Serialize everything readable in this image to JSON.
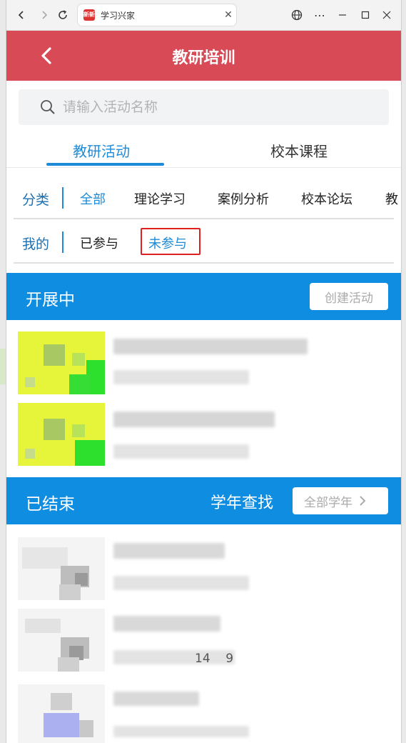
{
  "browser": {
    "tab_title": "学习兴家",
    "favicon_text": "新新",
    "icons": [
      "back-arrow-icon",
      "forward-arrow-icon",
      "refresh-icon",
      "close-icon",
      "globe-icon",
      "more-icon",
      "minimize-icon",
      "maximize-icon",
      "window-close-icon"
    ]
  },
  "app": {
    "title": "教研培训",
    "header_color": "#d94a57",
    "accent_color": "#1d8bd8"
  },
  "search": {
    "placeholder": "请输入活动名称",
    "value": ""
  },
  "main_tabs": [
    {
      "label": "教研活动",
      "active": true
    },
    {
      "label": "校本课程",
      "active": false
    }
  ],
  "filters": {
    "category": {
      "label": "分类",
      "items": [
        "全部",
        "理论学习",
        "案例分析",
        "校本论坛",
        "教"
      ],
      "selected": "全部"
    },
    "mine": {
      "label": "我的",
      "items": [
        "已参与",
        "未参与"
      ],
      "selected": "未参与"
    }
  },
  "ongoing": {
    "title": "开展中",
    "create_button": "创建活动"
  },
  "ended": {
    "title": "已结束",
    "year_search_label": "学年查找",
    "year_select": "全部学年"
  },
  "ended_cards": [
    {
      "partial_text": ""
    },
    {
      "partial_text": "14    9"
    },
    {
      "partial_text": ""
    }
  ]
}
